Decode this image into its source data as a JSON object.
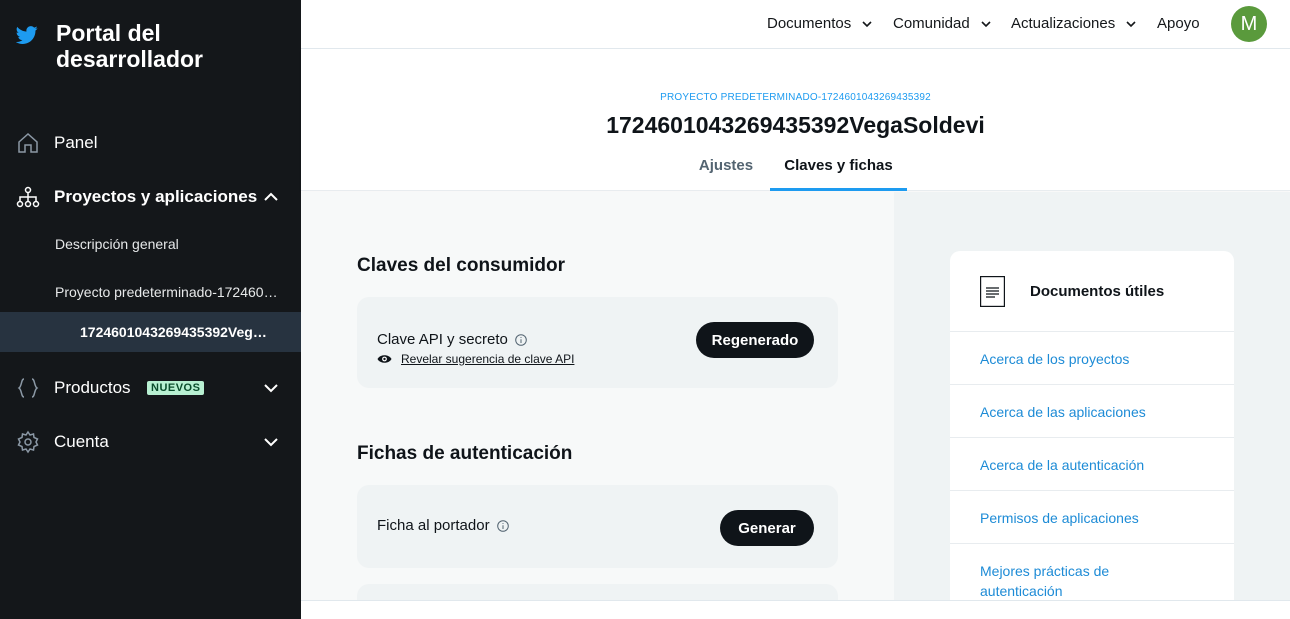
{
  "sidebar": {
    "brand_title": "Portal del desarrollador",
    "panel_label": "Panel",
    "projects_label": "Proyectos y aplicaciones",
    "overview_label": "Descripción general",
    "project_label": "Proyecto predeterminado-172460…",
    "app_label": "1724601043269435392Veg…",
    "products_label": "Productos",
    "products_badge": "NUEVOS",
    "account_label": "Cuenta"
  },
  "topnav": {
    "docs": "Documentos",
    "community": "Comunidad",
    "updates": "Actualizaciones",
    "support": "Apoyo",
    "avatar_initial": "M"
  },
  "header": {
    "breadcrumb": "PROYECTO PREDETERMINADO-1724601043269435392",
    "title": "1724601043269435392VegaSoldevi",
    "tabs": [
      {
        "label": "Ajustes",
        "active": false
      },
      {
        "label": "Claves y fichas",
        "active": true
      }
    ]
  },
  "main": {
    "consumer_title": "Claves del consumidor",
    "api_key_label": "Clave API y secreto",
    "reveal_hint": "Revelar sugerencia de clave API",
    "regen_button": "Regenerado",
    "auth_title": "Fichas de autenticación",
    "bearer_label": "Ficha al portador",
    "generate_button": "Generar"
  },
  "docs": {
    "title": "Documentos útiles",
    "links": [
      "Acerca de los proyectos",
      "Acerca de las aplicaciones",
      "Acerca de la autenticación",
      "Permisos de aplicaciones",
      "Mejores prácticas de autenticación"
    ]
  },
  "colors": {
    "sidebar_bg": "#14171a",
    "accent": "#1d9bf0",
    "button_bg": "#0f1419",
    "badge_bg": "#b8f0d2",
    "avatar_bg": "#5a9a3c"
  }
}
